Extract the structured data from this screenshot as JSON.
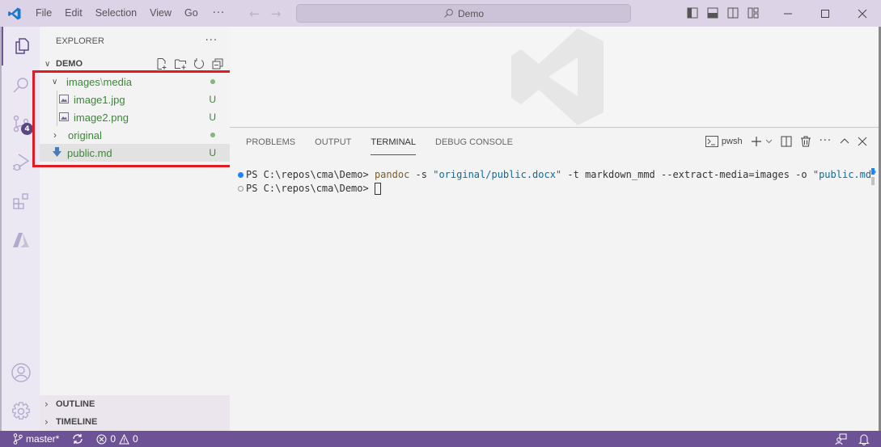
{
  "titlebar": {
    "menu": [
      "File",
      "Edit",
      "Selection",
      "View",
      "Go"
    ],
    "more": "···",
    "search_text": "Demo",
    "icons": [
      "toggle-primary-sidebar-icon",
      "toggle-panel-icon",
      "toggle-secondary-sidebar-icon",
      "customize-layout-icon"
    ]
  },
  "activitybar": {
    "items": [
      "explorer",
      "search",
      "source-control",
      "run-and-debug",
      "extensions",
      "azure"
    ],
    "source_control_badge": "4",
    "bottom": [
      "accounts",
      "manage"
    ]
  },
  "sidebar": {
    "title": "EXPLORER",
    "more": "···",
    "workspace": "DEMO",
    "tree": [
      {
        "label": "images",
        "sep": "\\",
        "label2": "media",
        "type": "folder",
        "expanded": true,
        "status": "dot"
      },
      {
        "label": "image1.jpg",
        "type": "image",
        "status": "U"
      },
      {
        "label": "image2.png",
        "type": "image",
        "status": "U"
      },
      {
        "label": "original",
        "type": "folder",
        "expanded": false,
        "status": "dot"
      },
      {
        "label": "public.md",
        "type": "markdown",
        "status": "U",
        "selected": true
      }
    ],
    "outline": "OUTLINE",
    "timeline": "TIMELINE"
  },
  "panel": {
    "tabs": [
      "PROBLEMS",
      "OUTPUT",
      "TERMINAL",
      "DEBUG CONSOLE"
    ],
    "active_tab": "TERMINAL",
    "terminal_name": "pwsh",
    "terminal": {
      "prompt": "PS C:\\repos\\cma\\Demo> ",
      "cmd": "pandoc",
      "arg1": " -s ",
      "str1": "\"original/public.docx\"",
      "arg2": " -t markdown_mmd --extract-media=images -o ",
      "str2": "\"public.md\"",
      "prompt2": "PS C:\\repos\\cma\\Demo> "
    }
  },
  "statusbar": {
    "branch": "master*",
    "errors": "0",
    "warnings": "0"
  },
  "colors": {
    "titlebar": "#dcd3e6",
    "statusbar": "#6d5396",
    "git_untracked": "#388a34",
    "highlight": "#e11b22"
  }
}
